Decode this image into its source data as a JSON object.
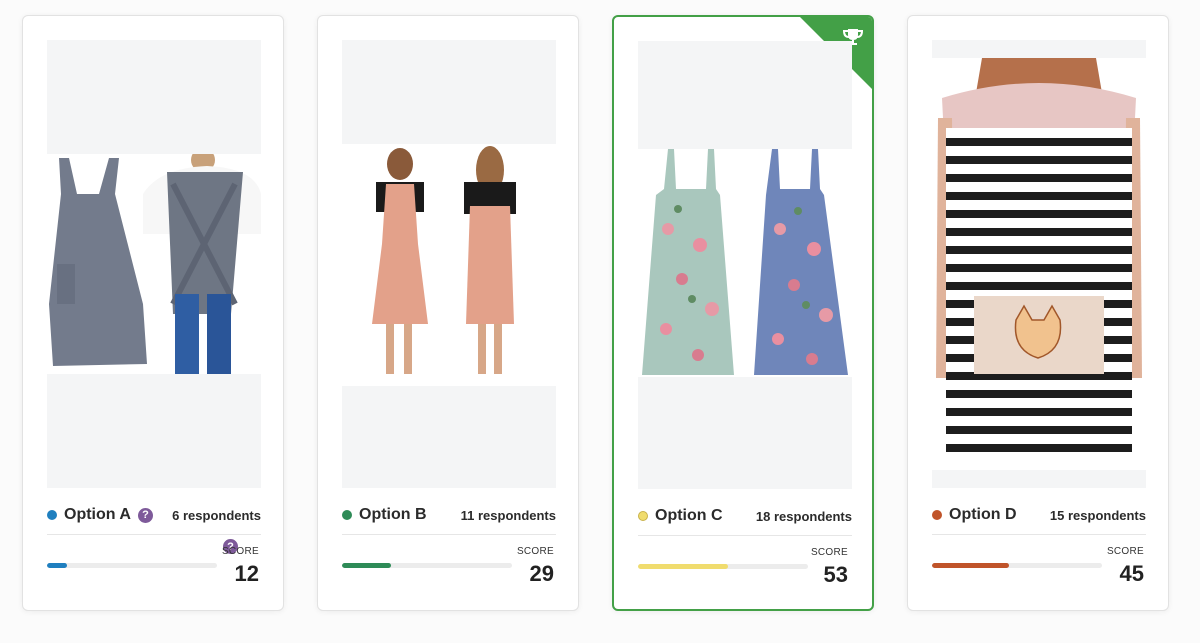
{
  "options": [
    {
      "name": "Option A",
      "respondents": "6 respondents",
      "score_label": "SCORE",
      "score": "12",
      "progress": 0.12,
      "color": "#1f7fbf"
    },
    {
      "name": "Option B",
      "respondents": "11 respondents",
      "score_label": "SCORE",
      "score": "29",
      "progress": 0.29,
      "color": "#2e8b57"
    },
    {
      "name": "Option C",
      "respondents": "18 respondents",
      "score_label": "SCORE",
      "score": "53",
      "progress": 0.53,
      "color": "#f0dc6e",
      "winner": true
    },
    {
      "name": "Option D",
      "respondents": "15 respondents",
      "score_label": "SCORE",
      "score": "45",
      "progress": 0.45,
      "color": "#c0542a"
    }
  ],
  "help_icon": "?",
  "winner_icon": "trophy-icon"
}
